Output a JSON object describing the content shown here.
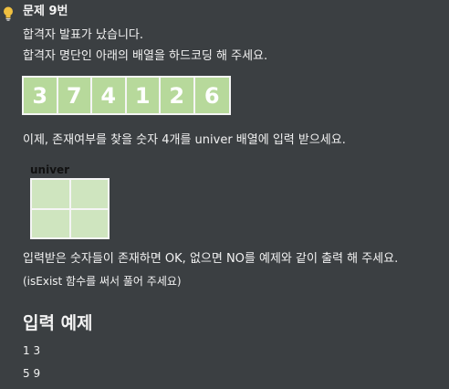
{
  "problem": {
    "title": "문제 9번",
    "intro": "합격자 발표가 났습니다.",
    "instruction1": "합격자 명단인 아래의 배열을 하드코딩 해 주세요.",
    "array_values": [
      "3",
      "7",
      "4",
      "1",
      "2",
      "6"
    ],
    "instruction2": "이제, 존재여부를 찾을 숫자 4개를 univer 배열에 입력 받으세요.",
    "univer_label": "univer",
    "instruction3": "입력받은 숫자들이 존재하면 OK, 없으면 NO를 예제와 같이 출력 해 주세요.",
    "instruction4": "(isExist 함수를 써서 풀어 주세요)"
  },
  "example": {
    "heading": "입력 예제",
    "lines": [
      "1 3",
      "5 9"
    ]
  },
  "colors": {
    "background": "#3b3f42",
    "array_cell": "#b7d99b",
    "univer_cell": "#cfe5bf",
    "icon": "#f0c040"
  },
  "icon": "lightbulb-icon"
}
